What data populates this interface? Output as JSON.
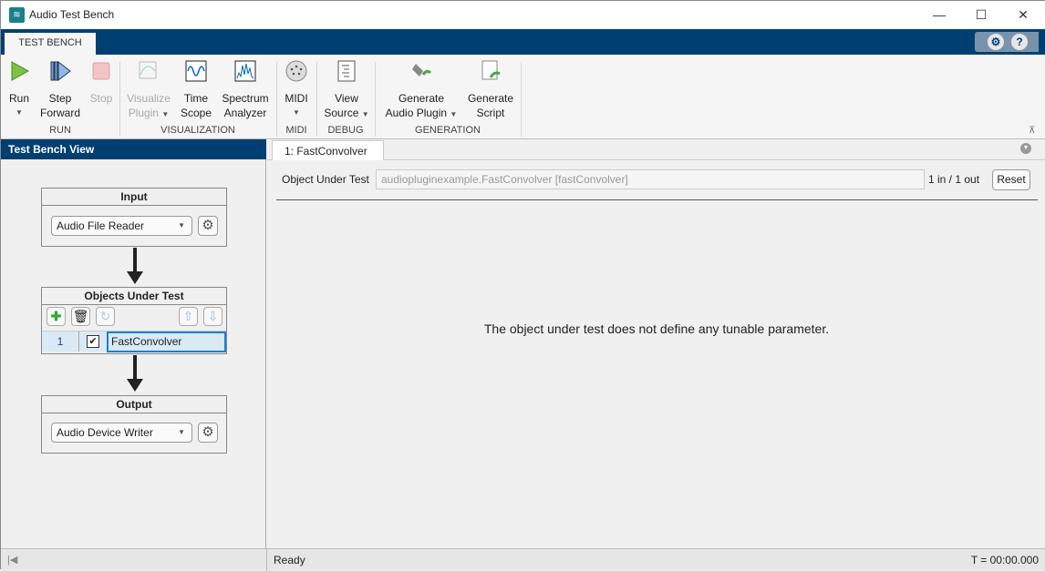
{
  "window": {
    "title": "Audio Test Bench",
    "minimize": "—",
    "maximize": "☐",
    "close": "✕"
  },
  "tabs": [
    {
      "label": "TEST BENCH"
    }
  ],
  "ribbon": {
    "run": {
      "label": "Run"
    },
    "step": {
      "label1": "Step",
      "label2": "Forward"
    },
    "stop": {
      "label": "Stop"
    },
    "visualize": {
      "label1": "Visualize",
      "label2": "Plugin"
    },
    "time_scope": {
      "label1": "Time",
      "label2": "Scope"
    },
    "spectrum": {
      "label1": "Spectrum",
      "label2": "Analyzer"
    },
    "midi": {
      "label": "MIDI"
    },
    "view_source": {
      "label1": "View",
      "label2": "Source"
    },
    "gen_plugin": {
      "label1": "Generate",
      "label2": "Audio Plugin"
    },
    "gen_script": {
      "label1": "Generate",
      "label2": "Script"
    },
    "groups": [
      "RUN",
      "VISUALIZATION",
      "MIDI",
      "DEBUG",
      "GENERATION"
    ]
  },
  "left": {
    "title": "Test Bench View",
    "input": {
      "title": "Input",
      "value": "Audio File Reader"
    },
    "objects": {
      "title": "Objects Under Test",
      "rows": [
        {
          "index": "1",
          "checked": true,
          "name": "FastConvolver"
        }
      ]
    },
    "output": {
      "title": "Output",
      "value": "Audio Device Writer"
    }
  },
  "doc": {
    "tab": "1: FastConvolver",
    "object_label": "Object Under Test",
    "object_value": "audiopluginexample.FastConvolver [fastConvolver]",
    "io": "1 in / 1 out",
    "reset": "Reset",
    "message": "The object under test does not define any tunable parameter."
  },
  "status": {
    "left": "Ready",
    "right": "T = 00:00.000"
  },
  "colors": {
    "accent": "#003f72"
  }
}
